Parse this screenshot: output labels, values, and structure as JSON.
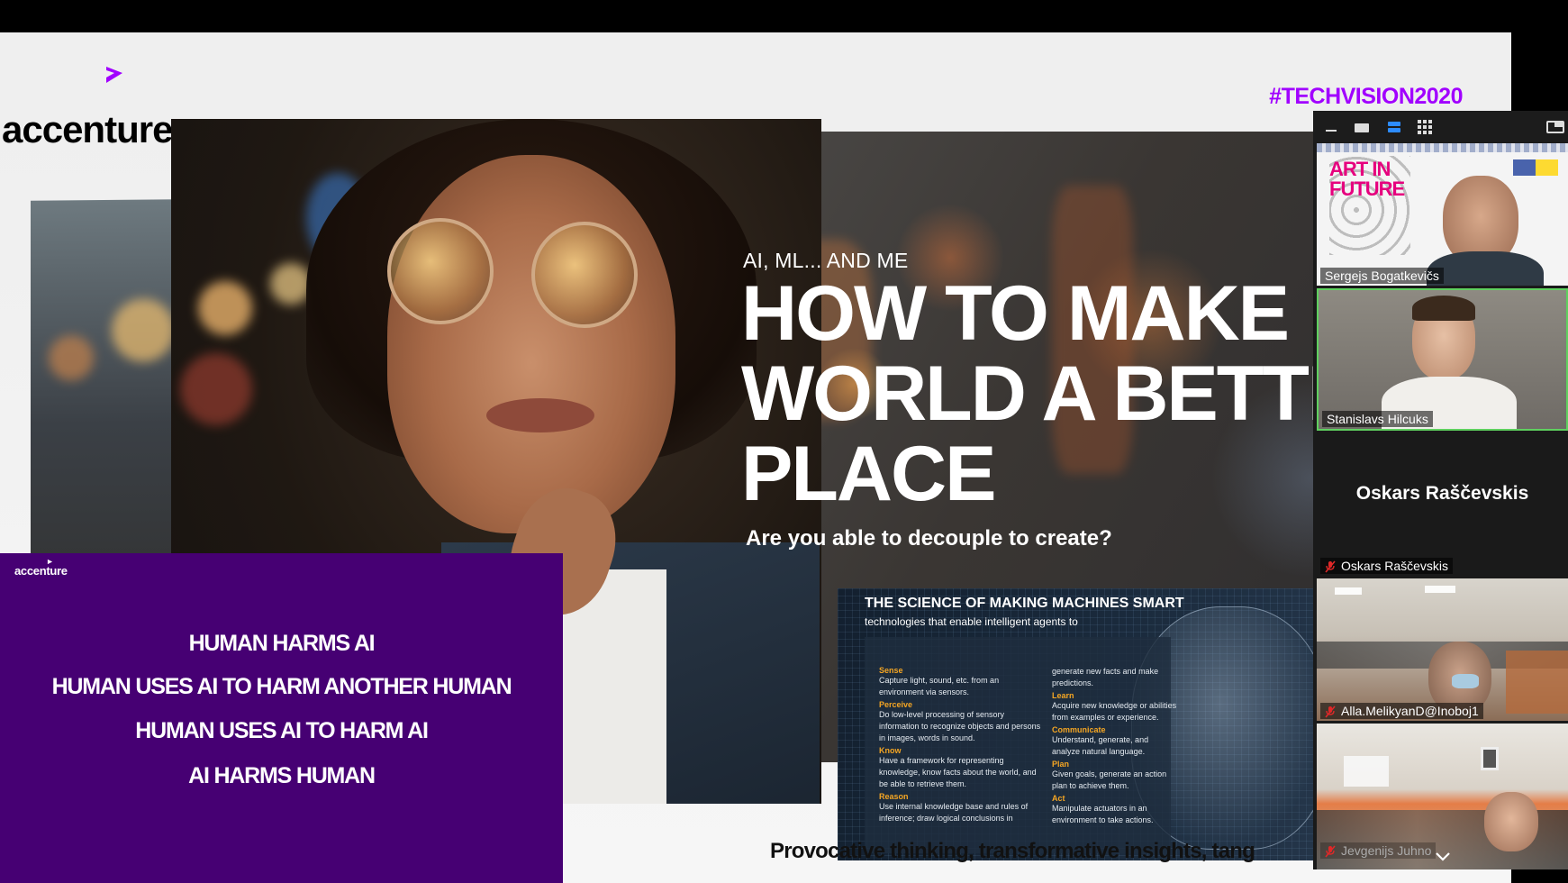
{
  "slide": {
    "logo_text": "accenture",
    "hashtag": "#TECHVISION2020",
    "kicker": "AI, ML... AND ME",
    "title_lines": [
      "HOW TO MAKE",
      "WORLD A BETTE",
      "PLACE"
    ],
    "subtitle": "Are you able to decouple to create?",
    "tagline": "Provocative thinking, transformative insights, tang",
    "colors": {
      "accent": "#a100ff",
      "purple_panel": "#460073"
    }
  },
  "purple_slide": {
    "logo_text": "accenture",
    "lines": [
      "HUMAN HARMS AI",
      "HUMAN USES AI TO HARM ANOTHER HUMAN",
      "HUMAN USES AI TO HARM AI",
      "AI HARMS HUMAN"
    ]
  },
  "science_slide": {
    "title": "THE SCIENCE OF MAKING MACHINES SMART",
    "subtitle": "technologies that enable intelligent agents to",
    "left_items": [
      {
        "term": "Sense",
        "desc": "Capture light, sound, etc. from an environment via sensors."
      },
      {
        "term": "Perceive",
        "desc": "Do low-level processing of sensory information to recognize objects and persons in images, words in sound."
      },
      {
        "term": "Know",
        "desc": "Have a framework for representing knowledge, know facts about the world, and be able to retrieve them."
      },
      {
        "term": "Reason",
        "desc": "Use internal knowledge base and rules of inference; draw logical conclusions in"
      }
    ],
    "right_items": [
      {
        "term": "",
        "desc": "generate new facts and make predictions."
      },
      {
        "term": "Learn",
        "desc": "Acquire new knowledge or abilities from examples or experience."
      },
      {
        "term": "Communicate",
        "desc": "Understand, generate, and analyze natural language."
      },
      {
        "term": "Plan",
        "desc": "Given goals, generate an action plan to achieve them."
      },
      {
        "term": "Act",
        "desc": "Manipulate actuators in an environment to take actions."
      }
    ]
  },
  "video_panel": {
    "toolbar_icons": [
      "minimize-icon",
      "speaker-view-icon",
      "strip-view-icon",
      "gallery-view-icon",
      "exit-fullscreen-icon"
    ],
    "participants": [
      {
        "name": "Sergejs Bogatkevičs",
        "muted": false,
        "banner_text": "ART IN FUTURE"
      },
      {
        "name": "Stanislavs Hilcuks",
        "muted": false
      },
      {
        "name": "Oskars Raščevskis",
        "muted": true,
        "video_off": true
      },
      {
        "name": "Alla.MelikyanD@Inoboj1",
        "muted": true
      },
      {
        "name": "Jevgenijs Juhno",
        "muted": true
      }
    ]
  }
}
